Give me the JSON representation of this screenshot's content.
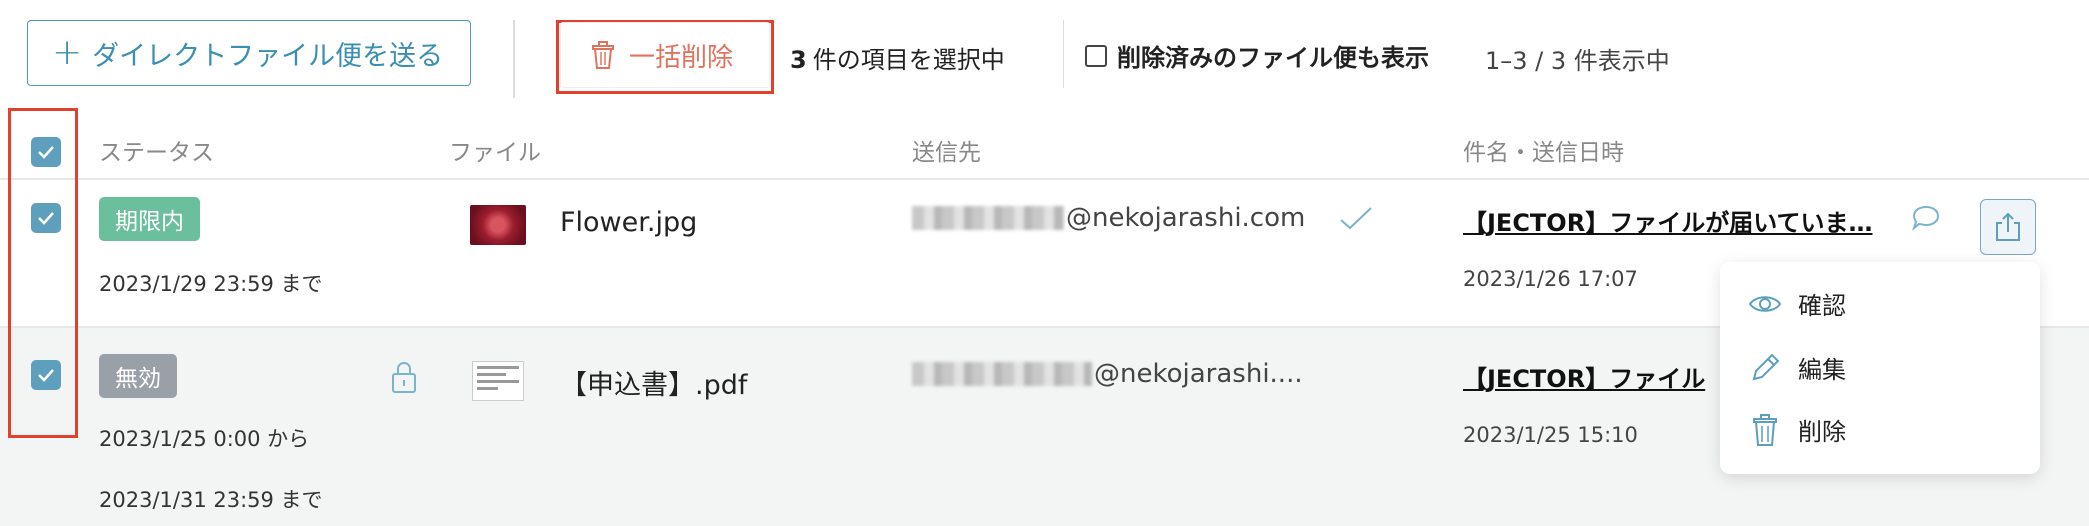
{
  "toolbar": {
    "send_label": "ダイレクトファイル便を送る",
    "bulk_delete_label": "一括削除",
    "selected_count": "3",
    "selected_suffix": "件の項目を選択中",
    "show_deleted_label": "削除済みのファイル便も表示",
    "range_label": "1–3 / 3 件表示中"
  },
  "columns": {
    "status": "ステータス",
    "file": "ファイル",
    "recipient": "送信先",
    "subject_date": "件名・送信日時"
  },
  "rows": [
    {
      "status_badge": "期限内",
      "status_color": "#6cbf9d",
      "date_line1": "2023/1/29 23:59 まで",
      "file_name": "Flower.jpg",
      "email_domain": "@nekojarashi.com",
      "subject": "【JECTOR】ファイルが届いていま…",
      "sent_at": "2023/1/26 17:07"
    },
    {
      "status_badge": "無効",
      "status_color": "#9aa0a7",
      "date_line1": "2023/1/25 0:00 から",
      "date_line2": "2023/1/31 23:59 まで",
      "file_name": "【申込書】.pdf",
      "email_domain": "@nekojarashi....",
      "subject": "【JECTOR】ファイル",
      "sent_at": "2023/1/25 15:10"
    }
  ],
  "menu": {
    "view_label": "確認",
    "edit_label": "編集",
    "delete_label": "削除"
  },
  "colors": {
    "accent": "#5e9fbe",
    "danger": "#e1402d"
  }
}
